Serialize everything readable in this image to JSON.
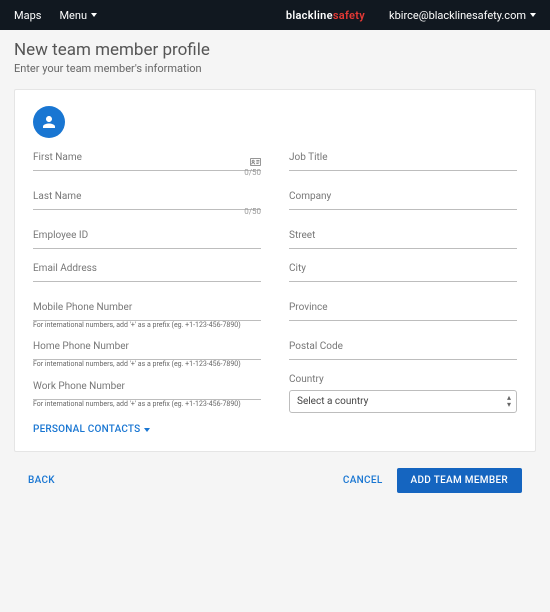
{
  "topbar": {
    "maps": "Maps",
    "menu": "Menu",
    "brand_black": "blackline",
    "brand_red": "safety",
    "email": "kbirce@blacklinesafety.com"
  },
  "page": {
    "title": "New team member profile",
    "subtitle": "Enter your team member's information"
  },
  "fields": {
    "first_name": "First Name",
    "first_name_counter": "0/50",
    "last_name": "Last Name",
    "last_name_counter": "0/50",
    "employee_id": "Employee ID",
    "email": "Email Address",
    "mobile": "Mobile Phone Number",
    "home": "Home Phone Number",
    "work": "Work Phone Number",
    "intl_hint": "For international numbers, add '+' as a prefix (eg. +1-123-456-7890)",
    "job_title": "Job Title",
    "company": "Company",
    "street": "Street",
    "city": "City",
    "province": "Province",
    "postal": "Postal Code",
    "country_label": "Country",
    "country_placeholder": "Select a country"
  },
  "expander": {
    "label": "PERSONAL CONTACTS"
  },
  "footer": {
    "back": "BACK",
    "cancel": "CANCEL",
    "add": "ADD TEAM MEMBER"
  }
}
